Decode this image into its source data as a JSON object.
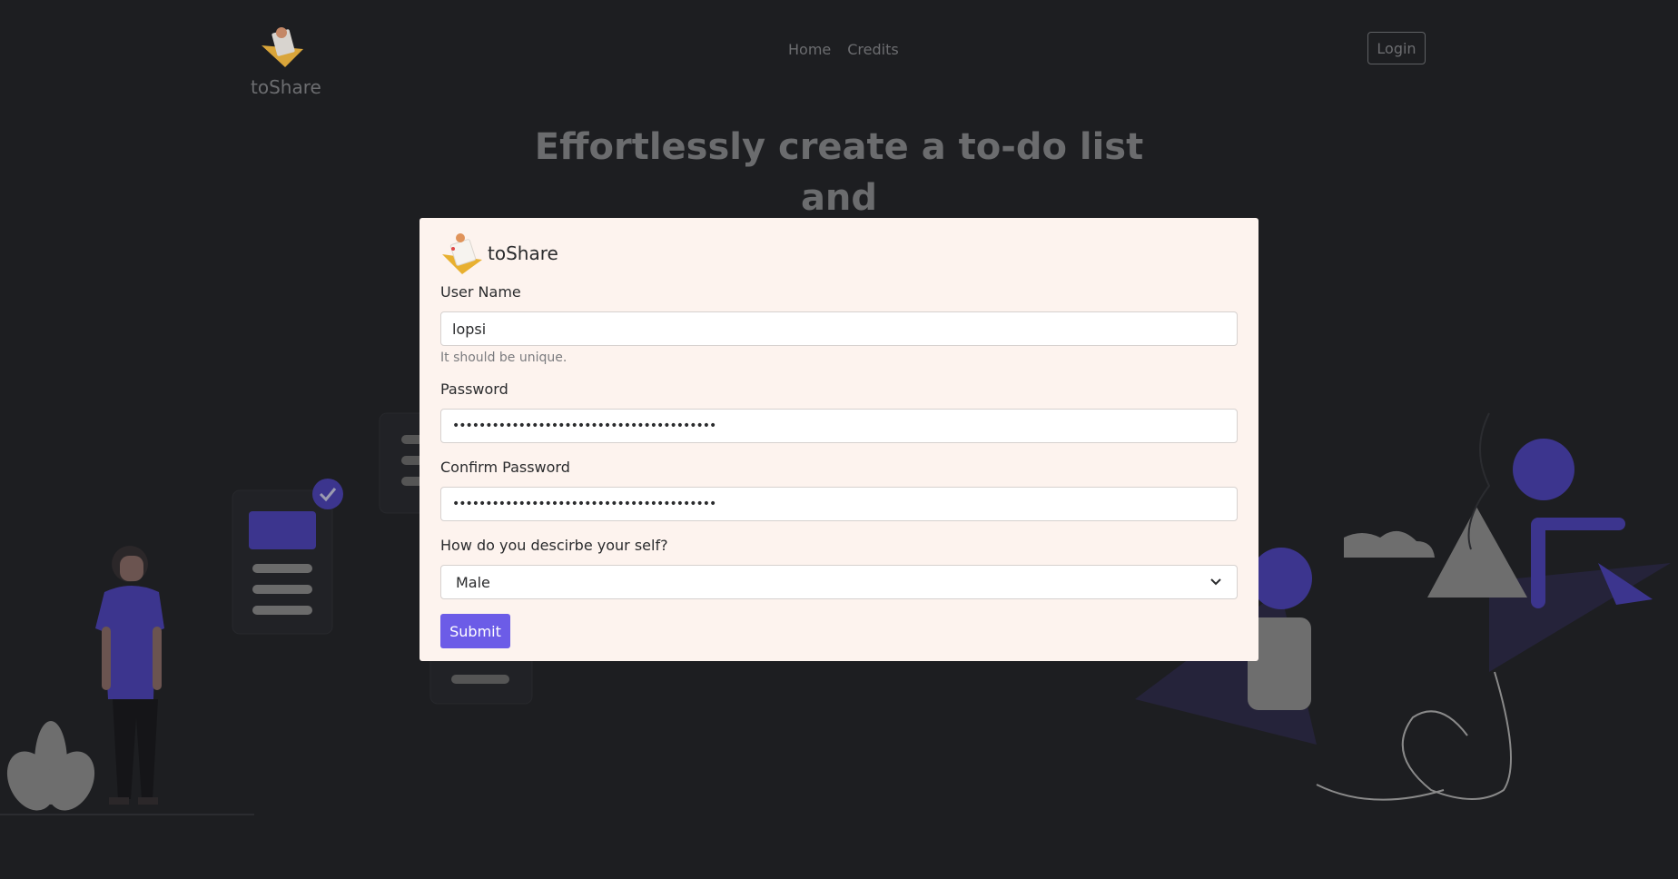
{
  "header": {
    "brand_name": "toShare",
    "nav": [
      {
        "label": "Home"
      },
      {
        "label": "Credits"
      }
    ],
    "login_label": "Login"
  },
  "hero": {
    "line1": "Effortlessly create a to-do list",
    "line2": "and"
  },
  "modal": {
    "brand_name": "toShare",
    "username": {
      "label": "User Name",
      "value": "lopsi",
      "hint": "It should be unique."
    },
    "password": {
      "label": "Password",
      "value": "••••••••••••••••••••••••••••••••••••••••"
    },
    "confirm_password": {
      "label": "Confirm Password",
      "value": "••••••••••••••••••••••••••••••••••••••••"
    },
    "describe": {
      "label": "How do you descirbe your self?",
      "selected": "Male"
    },
    "submit_label": "Submit"
  },
  "colors": {
    "background": "#1d1e21",
    "accent": "#6c5ce7",
    "modal_bg": "#fdf3ee",
    "illustration_purple": "#3c358e"
  },
  "icons": [
    "toshare-logo-icon",
    "chevron-down-icon",
    "check-icon"
  ]
}
